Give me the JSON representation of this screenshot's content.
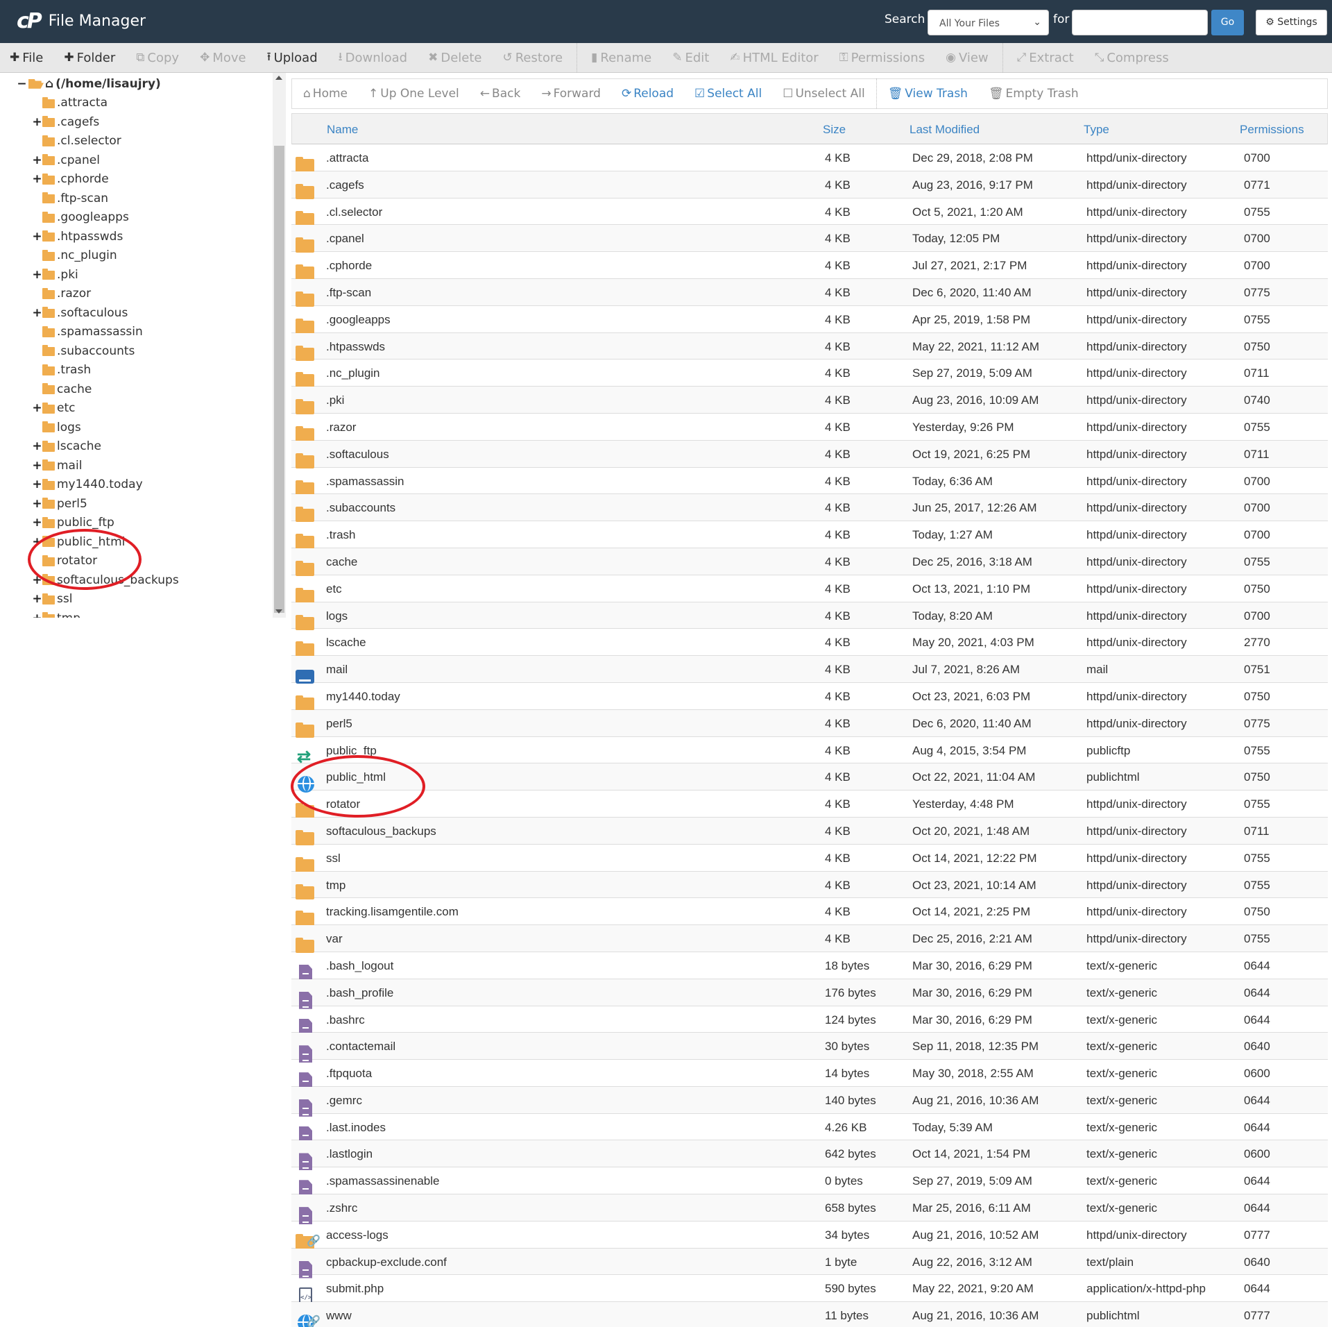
{
  "header": {
    "logo": "cP",
    "title": "File Manager",
    "search_label": "Search",
    "search_scope": "All Your Files",
    "for_label": "for",
    "search_value": "",
    "go_label": "Go",
    "settings_label": "Settings"
  },
  "toolbar": [
    {
      "icon": "plus-icon",
      "glyph": "✚",
      "label": "File",
      "enabled": true
    },
    {
      "icon": "plus-icon",
      "glyph": "✚",
      "label": "Folder",
      "enabled": true
    },
    {
      "icon": "copy-icon",
      "glyph": "⧉",
      "label": "Copy",
      "enabled": false
    },
    {
      "icon": "move-icon",
      "glyph": "✥",
      "label": "Move",
      "enabled": false
    },
    {
      "icon": "upload-icon",
      "glyph": "⭱",
      "label": "Upload",
      "enabled": true
    },
    {
      "icon": "download-icon",
      "glyph": "⭳",
      "label": "Download",
      "enabled": false
    },
    {
      "icon": "delete-icon",
      "glyph": "✖",
      "label": "Delete",
      "enabled": false
    },
    {
      "icon": "restore-icon",
      "glyph": "↺",
      "label": "Restore",
      "enabled": false
    },
    {
      "icon": "rename-icon",
      "glyph": "▮",
      "label": "Rename",
      "enabled": false
    },
    {
      "icon": "edit-icon",
      "glyph": "✎",
      "label": "Edit",
      "enabled": false
    },
    {
      "icon": "html-editor-icon",
      "glyph": "✍",
      "label": "HTML Editor",
      "enabled": false
    },
    {
      "icon": "key-icon",
      "glyph": "⚿",
      "label": "Permissions",
      "enabled": false
    },
    {
      "icon": "eye-icon",
      "glyph": "◉",
      "label": "View",
      "enabled": false
    },
    {
      "icon": "extract-icon",
      "glyph": "⤢",
      "label": "Extract",
      "enabled": false
    },
    {
      "icon": "compress-icon",
      "glyph": "⤡",
      "label": "Compress",
      "enabled": false
    }
  ],
  "tree": {
    "root_label": "(/home/lisaujry)",
    "items": [
      {
        "label": ".attracta",
        "expandable": false
      },
      {
        "label": ".cagefs",
        "expandable": true
      },
      {
        "label": ".cl.selector",
        "expandable": false
      },
      {
        "label": ".cpanel",
        "expandable": true
      },
      {
        "label": ".cphorde",
        "expandable": true
      },
      {
        "label": ".ftp-scan",
        "expandable": false
      },
      {
        "label": ".googleapps",
        "expandable": false
      },
      {
        "label": ".htpasswds",
        "expandable": true
      },
      {
        "label": ".nc_plugin",
        "expandable": false
      },
      {
        "label": ".pki",
        "expandable": true
      },
      {
        "label": ".razor",
        "expandable": false
      },
      {
        "label": ".softaculous",
        "expandable": true
      },
      {
        "label": ".spamassassin",
        "expandable": false
      },
      {
        "label": ".subaccounts",
        "expandable": false
      },
      {
        "label": ".trash",
        "expandable": false
      },
      {
        "label": "cache",
        "expandable": false
      },
      {
        "label": "etc",
        "expandable": true
      },
      {
        "label": "logs",
        "expandable": false
      },
      {
        "label": "lscache",
        "expandable": true
      },
      {
        "label": "mail",
        "expandable": true
      },
      {
        "label": "my1440.today",
        "expandable": true
      },
      {
        "label": "perl5",
        "expandable": true
      },
      {
        "label": "public_ftp",
        "expandable": true
      },
      {
        "label": "public_html",
        "expandable": true
      },
      {
        "label": "rotator",
        "expandable": false
      },
      {
        "label": "softaculous_backups",
        "expandable": true
      },
      {
        "label": "ssl",
        "expandable": true
      },
      {
        "label": "tmp",
        "expandable": true
      }
    ]
  },
  "nav": [
    {
      "icon": "home-icon",
      "glyph": "⌂",
      "label": "Home",
      "style": "gray"
    },
    {
      "icon": "up-level-icon",
      "glyph": "↑",
      "label": "Up One Level",
      "style": "gray"
    },
    {
      "icon": "back-icon",
      "glyph": "←",
      "label": "Back",
      "style": "gray"
    },
    {
      "icon": "forward-icon",
      "glyph": "→",
      "label": "Forward",
      "style": "gray"
    },
    {
      "icon": "reload-icon",
      "glyph": "⟳",
      "label": "Reload",
      "style": "blue"
    },
    {
      "icon": "checkbox-checked-icon",
      "glyph": "☑",
      "label": "Select All",
      "style": "blue"
    },
    {
      "icon": "checkbox-empty-icon",
      "glyph": "☐",
      "label": "Unselect All",
      "style": "gray"
    },
    {
      "icon": "trash-icon",
      "glyph": "🗑",
      "label": "View Trash",
      "style": "blue"
    },
    {
      "icon": "trash-icon",
      "glyph": "🗑",
      "label": "Empty Trash",
      "style": "gray"
    }
  ],
  "columns": {
    "name": "Name",
    "size": "Size",
    "modified": "Last Modified",
    "type": "Type",
    "permissions": "Permissions"
  },
  "files": [
    {
      "icon": "folder",
      "name": ".attracta",
      "size": "4 KB",
      "modified": "Dec 29, 2018, 2:08 PM",
      "type": "httpd/unix-directory",
      "perms": "0700"
    },
    {
      "icon": "folder",
      "name": ".cagefs",
      "size": "4 KB",
      "modified": "Aug 23, 2016, 9:17 PM",
      "type": "httpd/unix-directory",
      "perms": "0771"
    },
    {
      "icon": "folder",
      "name": ".cl.selector",
      "size": "4 KB",
      "modified": "Oct 5, 2021, 1:20 AM",
      "type": "httpd/unix-directory",
      "perms": "0755"
    },
    {
      "icon": "folder",
      "name": ".cpanel",
      "size": "4 KB",
      "modified": "Today, 12:05 PM",
      "type": "httpd/unix-directory",
      "perms": "0700"
    },
    {
      "icon": "folder",
      "name": ".cphorde",
      "size": "4 KB",
      "modified": "Jul 27, 2021, 2:17 PM",
      "type": "httpd/unix-directory",
      "perms": "0700"
    },
    {
      "icon": "folder",
      "name": ".ftp-scan",
      "size": "4 KB",
      "modified": "Dec 6, 2020, 11:40 AM",
      "type": "httpd/unix-directory",
      "perms": "0775"
    },
    {
      "icon": "folder",
      "name": ".googleapps",
      "size": "4 KB",
      "modified": "Apr 25, 2019, 1:58 PM",
      "type": "httpd/unix-directory",
      "perms": "0755"
    },
    {
      "icon": "folder",
      "name": ".htpasswds",
      "size": "4 KB",
      "modified": "May 22, 2021, 11:12 AM",
      "type": "httpd/unix-directory",
      "perms": "0750"
    },
    {
      "icon": "folder",
      "name": ".nc_plugin",
      "size": "4 KB",
      "modified": "Sep 27, 2019, 5:09 AM",
      "type": "httpd/unix-directory",
      "perms": "0711"
    },
    {
      "icon": "folder",
      "name": ".pki",
      "size": "4 KB",
      "modified": "Aug 23, 2016, 10:09 AM",
      "type": "httpd/unix-directory",
      "perms": "0740"
    },
    {
      "icon": "folder",
      "name": ".razor",
      "size": "4 KB",
      "modified": "Yesterday, 9:26 PM",
      "type": "httpd/unix-directory",
      "perms": "0755"
    },
    {
      "icon": "folder",
      "name": ".softaculous",
      "size": "4 KB",
      "modified": "Oct 19, 2021, 6:25 PM",
      "type": "httpd/unix-directory",
      "perms": "0711"
    },
    {
      "icon": "folder",
      "name": ".spamassassin",
      "size": "4 KB",
      "modified": "Today, 6:36 AM",
      "type": "httpd/unix-directory",
      "perms": "0700"
    },
    {
      "icon": "folder",
      "name": ".subaccounts",
      "size": "4 KB",
      "modified": "Jun 25, 2017, 12:26 AM",
      "type": "httpd/unix-directory",
      "perms": "0700"
    },
    {
      "icon": "folder",
      "name": ".trash",
      "size": "4 KB",
      "modified": "Today, 1:27 AM",
      "type": "httpd/unix-directory",
      "perms": "0700"
    },
    {
      "icon": "folder",
      "name": "cache",
      "size": "4 KB",
      "modified": "Dec 25, 2016, 3:18 AM",
      "type": "httpd/unix-directory",
      "perms": "0755"
    },
    {
      "icon": "folder",
      "name": "etc",
      "size": "4 KB",
      "modified": "Oct 13, 2021, 1:10 PM",
      "type": "httpd/unix-directory",
      "perms": "0750"
    },
    {
      "icon": "folder",
      "name": "logs",
      "size": "4 KB",
      "modified": "Today, 8:20 AM",
      "type": "httpd/unix-directory",
      "perms": "0700"
    },
    {
      "icon": "folder",
      "name": "lscache",
      "size": "4 KB",
      "modified": "May 20, 2021, 4:03 PM",
      "type": "httpd/unix-directory",
      "perms": "2770"
    },
    {
      "icon": "mail",
      "name": "mail",
      "size": "4 KB",
      "modified": "Jul 7, 2021, 8:26 AM",
      "type": "mail",
      "perms": "0751"
    },
    {
      "icon": "folder",
      "name": "my1440.today",
      "size": "4 KB",
      "modified": "Oct 23, 2021, 6:03 PM",
      "type": "httpd/unix-directory",
      "perms": "0750"
    },
    {
      "icon": "folder",
      "name": "perl5",
      "size": "4 KB",
      "modified": "Dec 6, 2020, 11:40 AM",
      "type": "httpd/unix-directory",
      "perms": "0775"
    },
    {
      "icon": "ftp",
      "name": "public_ftp",
      "size": "4 KB",
      "modified": "Aug 4, 2015, 3:54 PM",
      "type": "publicftp",
      "perms": "0755"
    },
    {
      "icon": "globe",
      "name": "public_html",
      "size": "4 KB",
      "modified": "Oct 22, 2021, 11:04 AM",
      "type": "publichtml",
      "perms": "0750"
    },
    {
      "icon": "folder",
      "name": "rotator",
      "size": "4 KB",
      "modified": "Yesterday, 4:48 PM",
      "type": "httpd/unix-directory",
      "perms": "0755"
    },
    {
      "icon": "folder",
      "name": "softaculous_backups",
      "size": "4 KB",
      "modified": "Oct 20, 2021, 1:48 AM",
      "type": "httpd/unix-directory",
      "perms": "0711"
    },
    {
      "icon": "folder",
      "name": "ssl",
      "size": "4 KB",
      "modified": "Oct 14, 2021, 12:22 PM",
      "type": "httpd/unix-directory",
      "perms": "0755"
    },
    {
      "icon": "folder",
      "name": "tmp",
      "size": "4 KB",
      "modified": "Oct 23, 2021, 10:14 AM",
      "type": "httpd/unix-directory",
      "perms": "0755"
    },
    {
      "icon": "folder",
      "name": "tracking.lisamgentile.com",
      "size": "4 KB",
      "modified": "Oct 14, 2021, 2:25 PM",
      "type": "httpd/unix-directory",
      "perms": "0750"
    },
    {
      "icon": "folder",
      "name": "var",
      "size": "4 KB",
      "modified": "Dec 25, 2016, 2:21 AM",
      "type": "httpd/unix-directory",
      "perms": "0755"
    },
    {
      "icon": "file",
      "name": ".bash_logout",
      "size": "18 bytes",
      "modified": "Mar 30, 2016, 6:29 PM",
      "type": "text/x-generic",
      "perms": "0644"
    },
    {
      "icon": "file",
      "name": ".bash_profile",
      "size": "176 bytes",
      "modified": "Mar 30, 2016, 6:29 PM",
      "type": "text/x-generic",
      "perms": "0644"
    },
    {
      "icon": "file",
      "name": ".bashrc",
      "size": "124 bytes",
      "modified": "Mar 30, 2016, 6:29 PM",
      "type": "text/x-generic",
      "perms": "0644"
    },
    {
      "icon": "file",
      "name": ".contactemail",
      "size": "30 bytes",
      "modified": "Sep 11, 2018, 12:35 PM",
      "type": "text/x-generic",
      "perms": "0640"
    },
    {
      "icon": "file",
      "name": ".ftpquota",
      "size": "14 bytes",
      "modified": "May 30, 2018, 2:55 AM",
      "type": "text/x-generic",
      "perms": "0600"
    },
    {
      "icon": "file",
      "name": ".gemrc",
      "size": "140 bytes",
      "modified": "Aug 21, 2016, 10:36 AM",
      "type": "text/x-generic",
      "perms": "0644"
    },
    {
      "icon": "file",
      "name": ".last.inodes",
      "size": "4.26 KB",
      "modified": "Today, 5:39 AM",
      "type": "text/x-generic",
      "perms": "0644"
    },
    {
      "icon": "file",
      "name": ".lastlogin",
      "size": "642 bytes",
      "modified": "Oct 14, 2021, 1:54 PM",
      "type": "text/x-generic",
      "perms": "0600"
    },
    {
      "icon": "file",
      "name": ".spamassassinenable",
      "size": "0 bytes",
      "modified": "Sep 27, 2019, 5:09 AM",
      "type": "text/x-generic",
      "perms": "0644"
    },
    {
      "icon": "file",
      "name": ".zshrc",
      "size": "658 bytes",
      "modified": "Mar 25, 2016, 6:11 AM",
      "type": "text/x-generic",
      "perms": "0644"
    },
    {
      "icon": "folder-link",
      "name": "access-logs",
      "size": "34 bytes",
      "modified": "Aug 21, 2016, 10:52 AM",
      "type": "httpd/unix-directory",
      "perms": "0777"
    },
    {
      "icon": "file",
      "name": "cpbackup-exclude.conf",
      "size": "1 byte",
      "modified": "Aug 22, 2016, 3:12 AM",
      "type": "text/plain",
      "perms": "0640"
    },
    {
      "icon": "php",
      "name": "submit.php",
      "size": "590 bytes",
      "modified": "May 22, 2021, 9:20 AM",
      "type": "application/x-httpd-php",
      "perms": "0644"
    },
    {
      "icon": "globe-link",
      "name": "www",
      "size": "11 bytes",
      "modified": "Aug 21, 2016, 10:36 AM",
      "type": "publichtml",
      "perms": "0777"
    }
  ],
  "annotations": [
    "public_html",
    "rotator"
  ]
}
